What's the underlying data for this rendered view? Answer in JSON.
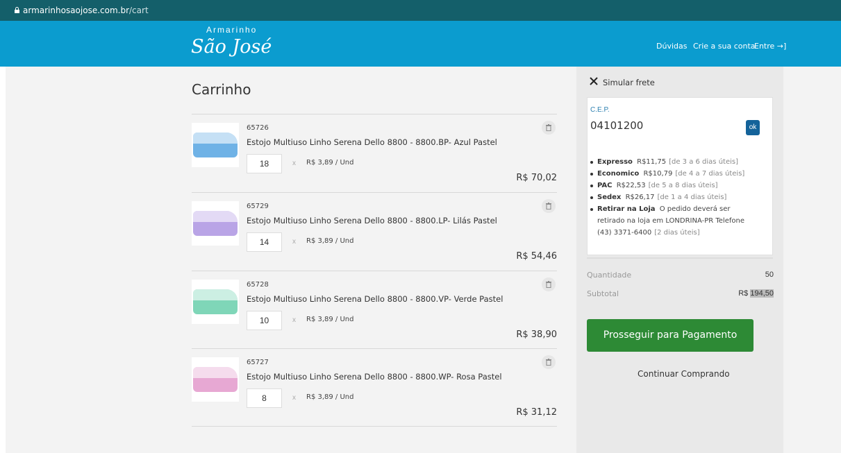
{
  "browser": {
    "url_host": "armarinhosaojose.com.br",
    "url_path": "/cart"
  },
  "header": {
    "logo_small": "Armarinho",
    "logo_big": "São José",
    "nav": {
      "duvidas": "Dúvidas",
      "crie": "Crie a sua conta",
      "entre": "Entre →]"
    }
  },
  "cart": {
    "title": "Carrinho",
    "items": [
      {
        "code": "65726",
        "name": "Estojo Multiuso Linho Serena Dello 8800 - 8800.BP- Azul Pastel",
        "qty": "18",
        "times": "x",
        "unit_price": "R$ 3,89 / Und",
        "total": "R$ 70,02",
        "color": "#6fb2e6"
      },
      {
        "code": "65729",
        "name": "Estojo Multiuso Linho Serena Dello 8800 - 8800.LP- Lilás Pastel",
        "qty": "14",
        "times": "x",
        "unit_price": "R$ 3,89 / Und",
        "total": "R$ 54,46",
        "color": "#b9a4e6"
      },
      {
        "code": "65728",
        "name": "Estojo Multiuso Linho Serena Dello 8800 - 8800.VP- Verde Pastel",
        "qty": "10",
        "times": "x",
        "unit_price": "R$ 3,89 / Und",
        "total": "R$ 38,90",
        "color": "#7fd6b8"
      },
      {
        "code": "65727",
        "name": "Estojo Multiuso Linho Serena Dello 8800 - 8800.WP- Rosa Pastel",
        "qty": "8",
        "times": "x",
        "unit_price": "R$ 3,89 / Und",
        "total": "R$ 31,12",
        "color": "#e7a8d3"
      }
    ]
  },
  "frete": {
    "label": "Simular frete",
    "cep_label": "C.E.P.",
    "cep_value": "04101200",
    "ok_label": "ok",
    "options": [
      {
        "name": "Expresso",
        "price": "R$11,75",
        "time": "[de 3 a 6 dias úteis]"
      },
      {
        "name": "Economico",
        "price": "R$10,79",
        "time": "[de 4 a 7 dias úteis]"
      },
      {
        "name": "PAC",
        "price": "R$22,53",
        "time": "[de 5 a 8 dias úteis]"
      },
      {
        "name": "Sedex",
        "price": "R$26,17",
        "time": "[de 1 a 4 dias úteis]"
      },
      {
        "name": "Retirar na Loja",
        "price": "O pedido deverá ser retirado na loja em LONDRINA-PR Telefone (43) 3371-6400",
        "time": "[2 dias úteis]"
      }
    ]
  },
  "summary": {
    "qty_label": "Quantidade",
    "qty_value": "50",
    "subtotal_label": "Subtotal",
    "subtotal_prefix": "R$ ",
    "subtotal_value": "194,50",
    "pay_button": "Prosseguir para Pagamento",
    "continue_label": "Continuar Comprando"
  },
  "colors": {
    "header": "#0b9ccf",
    "urlbar": "#145f6a",
    "pay_button": "#2d8a35",
    "ok_button": "#14639a"
  },
  "icons": {
    "lock": "lock-icon",
    "close": "close-icon",
    "trash": "trash-icon",
    "login": "login-icon"
  }
}
